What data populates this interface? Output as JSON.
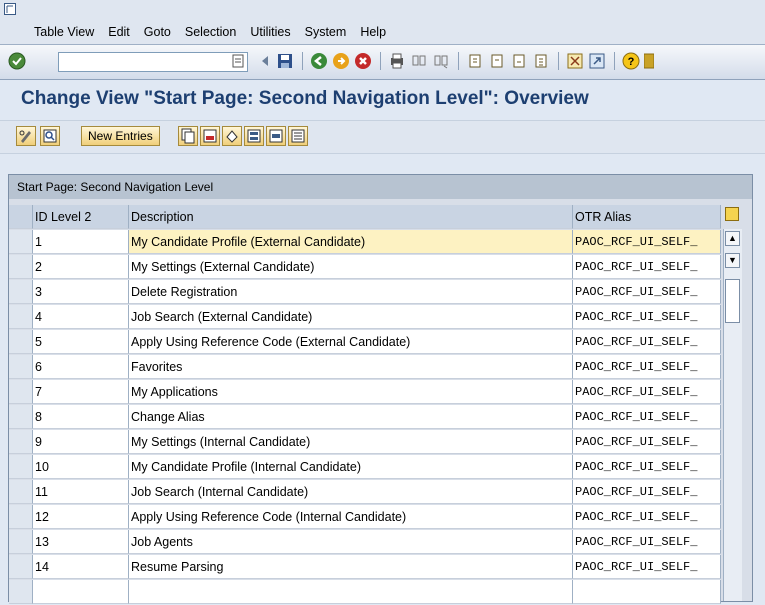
{
  "menu": {
    "items": [
      "Table View",
      "Edit",
      "Goto",
      "Selection",
      "Utilities",
      "System",
      "Help"
    ]
  },
  "toolbar": {
    "command_field_value": "",
    "icons": [
      "enter-icon",
      "history-icon",
      "back-arrow-icon",
      "save-icon",
      "back-icon",
      "exit-icon",
      "cancel-icon",
      "print-icon",
      "find-icon",
      "find-next-icon",
      "first-page-icon",
      "prev-page-icon",
      "next-page-icon",
      "last-page-icon",
      "create-session-icon",
      "shortcut-icon",
      "help-icon"
    ]
  },
  "title": "Change View \"Start Page: Second Navigation Level\": Overview",
  "app_toolbar": {
    "new_entries_label": "New Entries"
  },
  "table": {
    "title": "Start Page: Second Navigation Level",
    "headers": {
      "id": "ID Level 2",
      "description": "Description",
      "otr": "OTR Alias"
    },
    "rows": [
      {
        "id": "1",
        "description": "My Candidate Profile (External Candidate)",
        "otr": "PAOC_RCF_UI_SELF_"
      },
      {
        "id": "2",
        "description": "My Settings (External Candidate)",
        "otr": "PAOC_RCF_UI_SELF_"
      },
      {
        "id": "3",
        "description": "Delete Registration",
        "otr": "PAOC_RCF_UI_SELF_"
      },
      {
        "id": "4",
        "description": "Job Search (External Candidate)",
        "otr": "PAOC_RCF_UI_SELF_"
      },
      {
        "id": "5",
        "description": "Apply Using Reference Code (External Candidate)",
        "otr": "PAOC_RCF_UI_SELF_"
      },
      {
        "id": "6",
        "description": "Favorites",
        "otr": "PAOC_RCF_UI_SELF_"
      },
      {
        "id": "7",
        "description": "My Applications",
        "otr": "PAOC_RCF_UI_SELF_"
      },
      {
        "id": "8",
        "description": "Change Alias",
        "otr": "PAOC_RCF_UI_SELF_"
      },
      {
        "id": "9",
        "description": "My Settings (Internal Candidate)",
        "otr": "PAOC_RCF_UI_SELF_"
      },
      {
        "id": "10",
        "description": "My Candidate Profile (Internal Candidate)",
        "otr": "PAOC_RCF_UI_SELF_"
      },
      {
        "id": "11",
        "description": "Job Search (Internal Candidate)",
        "otr": "PAOC_RCF_UI_SELF_"
      },
      {
        "id": "12",
        "description": "Apply Using Reference Code (Internal Candidate)",
        "otr": "PAOC_RCF_UI_SELF_"
      },
      {
        "id": "13",
        "description": "Job Agents",
        "otr": "PAOC_RCF_UI_SELF_"
      },
      {
        "id": "14",
        "description": "Resume Parsing",
        "otr": "PAOC_RCF_UI_SELF_"
      }
    ]
  },
  "colors": {
    "title": "#1d3f71",
    "active_row": "#fdf2c2",
    "button": "#f0cf7a"
  }
}
